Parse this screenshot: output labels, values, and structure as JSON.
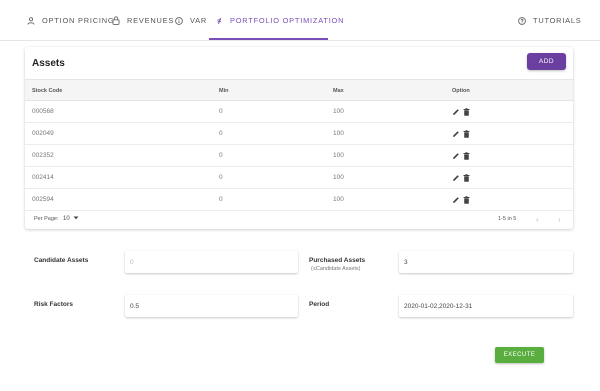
{
  "nav": {
    "tabs": [
      {
        "label": "OPTION PRICING",
        "icon": "person-icon"
      },
      {
        "label": "REVENUES",
        "icon": "lock-icon"
      },
      {
        "label": "VAR",
        "icon": "info-icon"
      },
      {
        "label": "PORTFOLIO OPTIMIZATION",
        "icon": "currency-icon",
        "active": true
      }
    ],
    "tutorials": {
      "label": "TUTORIALS",
      "icon": "help-circle-icon"
    }
  },
  "assets": {
    "title": "Assets",
    "add_label": "ADD",
    "columns": [
      "Stock Code",
      "Min",
      "Max",
      "Option"
    ],
    "rows": [
      {
        "code": "000568",
        "min": "0",
        "max": "100"
      },
      {
        "code": "002049",
        "min": "0",
        "max": "100"
      },
      {
        "code": "002352",
        "min": "0",
        "max": "100"
      },
      {
        "code": "002414",
        "min": "0",
        "max": "100"
      },
      {
        "code": "002594",
        "min": "0",
        "max": "100"
      }
    ],
    "per_page_label": "Per Page:",
    "per_page_value": "10",
    "range_text": "1-5 in 5",
    "prev_symbol": "‹",
    "next_symbol": "›"
  },
  "form": {
    "candidate_label": "Candidate Assets",
    "candidate_placeholder": "0",
    "purchased_label": "Purchased Assets",
    "purchased_sub": "(≤Candidate Assets)",
    "purchased_value": "3",
    "risk_label": "Risk Factors",
    "risk_value": "0.5",
    "period_label": "Period",
    "period_value": "2020-01-02,2020-12-31"
  },
  "execute_label": "EXECUTE",
  "colors": {
    "accent": "#7b4fb8",
    "add_button": "#6a3fa0",
    "execute_button": "#5aae3f"
  }
}
